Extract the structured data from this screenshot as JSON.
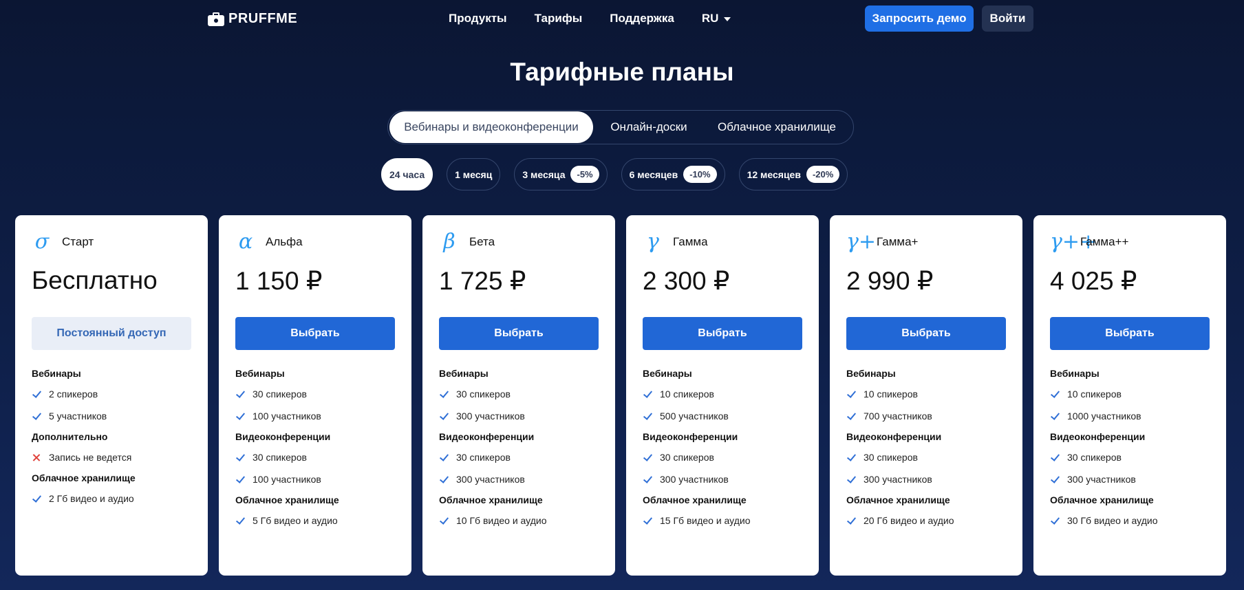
{
  "header": {
    "logo_text": "PRUFFME",
    "nav": [
      "Продукты",
      "Тарифы",
      "Поддержка"
    ],
    "lang": "RU",
    "demo_label": "Запросить демо",
    "login_label": "Войти"
  },
  "title": "Тарифные планы",
  "product_tabs": [
    "Вебинары и видеоконференции",
    "Онлайн-доски",
    "Облачное хранилище"
  ],
  "periods": [
    {
      "label": "24 часа",
      "discount": ""
    },
    {
      "label": "1 месяц",
      "discount": ""
    },
    {
      "label": "3 месяца",
      "discount": "-5%"
    },
    {
      "label": "6 месяцев",
      "discount": "-10%"
    },
    {
      "label": "12 месяцев",
      "discount": "-20%"
    }
  ],
  "colors": {
    "accent": "#1f6fe5",
    "icon": "#2d9bf0",
    "background": "#0b1633"
  },
  "plans": [
    {
      "icon": "σ",
      "icon_name": "sigma-icon",
      "name": "Старт",
      "price": "Бесплатно",
      "cta": "Постоянный доступ",
      "sections": [
        {
          "title": "Вебинары",
          "items": [
            {
              "text": "2 спикеров",
              "ok": true
            },
            {
              "text": "5 участников",
              "ok": true
            }
          ]
        },
        {
          "title": "Дополнительно",
          "items": [
            {
              "text": "Запись не ведется",
              "ok": false
            }
          ]
        },
        {
          "title": "Облачное хранилище",
          "items": [
            {
              "text": "2 Гб видео и аудио",
              "ok": true
            }
          ]
        }
      ]
    },
    {
      "icon": "α",
      "icon_name": "alpha-icon",
      "name": "Альфа",
      "price": "1 150 ₽",
      "cta": "Выбрать",
      "sections": [
        {
          "title": "Вебинары",
          "items": [
            {
              "text": "30 спикеров",
              "ok": true
            },
            {
              "text": "100 участников",
              "ok": true
            }
          ]
        },
        {
          "title": "Видеоконференции",
          "items": [
            {
              "text": "30 спикеров",
              "ok": true
            },
            {
              "text": "100 участников",
              "ok": true
            }
          ]
        },
        {
          "title": "Облачное хранилище",
          "items": [
            {
              "text": "5 Гб видео и аудио",
              "ok": true
            }
          ]
        }
      ]
    },
    {
      "icon": "β",
      "icon_name": "beta-icon",
      "name": "Бета",
      "price": "1 725 ₽",
      "cta": "Выбрать",
      "sections": [
        {
          "title": "Вебинары",
          "items": [
            {
              "text": "30 спикеров",
              "ok": true
            },
            {
              "text": "300 участников",
              "ok": true
            }
          ]
        },
        {
          "title": "Видеоконференции",
          "items": [
            {
              "text": "30 спикеров",
              "ok": true
            },
            {
              "text": "300 участников",
              "ok": true
            }
          ]
        },
        {
          "title": "Облачное хранилище",
          "items": [
            {
              "text": "10 Гб видео и аудио",
              "ok": true
            }
          ]
        }
      ]
    },
    {
      "icon": "γ",
      "icon_name": "gamma-icon",
      "name": "Гамма",
      "price": "2 300 ₽",
      "cta": "Выбрать",
      "sections": [
        {
          "title": "Вебинары",
          "items": [
            {
              "text": "10 спикеров",
              "ok": true
            },
            {
              "text": "500 участников",
              "ok": true
            }
          ]
        },
        {
          "title": "Видеоконференции",
          "items": [
            {
              "text": "30 спикеров",
              "ok": true
            },
            {
              "text": "300 участников",
              "ok": true
            }
          ]
        },
        {
          "title": "Облачное хранилище",
          "items": [
            {
              "text": "15 Гб видео и аудио",
              "ok": true
            }
          ]
        }
      ]
    },
    {
      "icon": "γ+",
      "icon_name": "gamma-plus-icon",
      "name": "Гамма+",
      "price": "2 990 ₽",
      "cta": "Выбрать",
      "sections": [
        {
          "title": "Вебинары",
          "items": [
            {
              "text": "10 спикеров",
              "ok": true
            },
            {
              "text": "700 участников",
              "ok": true
            }
          ]
        },
        {
          "title": "Видеоконференции",
          "items": [
            {
              "text": "30 спикеров",
              "ok": true
            },
            {
              "text": "300 участников",
              "ok": true
            }
          ]
        },
        {
          "title": "Облачное хранилище",
          "items": [
            {
              "text": "20 Гб видео и аудио",
              "ok": true
            }
          ]
        }
      ]
    },
    {
      "icon": "γ++",
      "icon_name": "gamma-plus-plus-icon",
      "name": "Гамма++",
      "price": "4 025 ₽",
      "cta": "Выбрать",
      "sections": [
        {
          "title": "Вебинары",
          "items": [
            {
              "text": "10 спикеров",
              "ok": true
            },
            {
              "text": "1000 участников",
              "ok": true
            }
          ]
        },
        {
          "title": "Видеоконференции",
          "items": [
            {
              "text": "30 спикеров",
              "ok": true
            },
            {
              "text": "300 участников",
              "ok": true
            }
          ]
        },
        {
          "title": "Облачное хранилище",
          "items": [
            {
              "text": "30 Гб видео и аудио",
              "ok": true
            }
          ]
        }
      ]
    }
  ]
}
